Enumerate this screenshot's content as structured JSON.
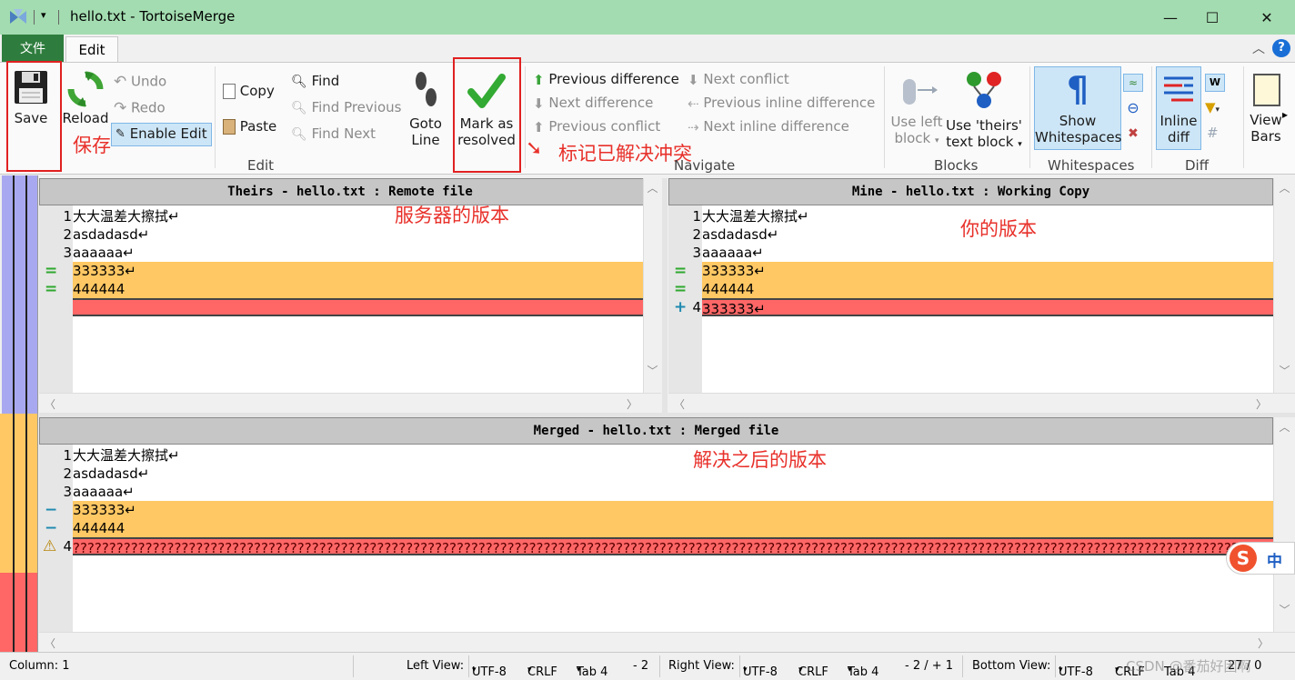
{
  "window": {
    "title": "hello.txt - TortoiseMerge",
    "minimize": "—",
    "maximize": "☐",
    "close": "✕"
  },
  "tabs": {
    "file": "文件",
    "edit": "Edit"
  },
  "ribbon": {
    "save": "Save",
    "reload": "Reload",
    "undo": "Undo",
    "redo": "Redo",
    "enable_edit": "Enable Edit",
    "copy": "Copy",
    "paste": "Paste",
    "find": "Find",
    "find_previous": "Find Previous",
    "find_next": "Find Next",
    "goto_1": "Goto",
    "goto_2": "Line",
    "mark_1": "Mark as",
    "mark_2": "resolved",
    "prev_diff": "Previous difference",
    "next_diff": "Next difference",
    "prev_conflict": "Previous conflict",
    "next_conflict": "Next conflict",
    "prev_inline": "Previous inline difference",
    "next_inline": "Next inline difference",
    "use_left_1": "Use left",
    "use_left_2": "block",
    "use_theirs_1": "Use 'theirs'",
    "use_theirs_2": "text block",
    "show_ws_1": "Show",
    "show_ws_2": "Whitespaces",
    "inline_1": "Inline",
    "inline_2": "diff",
    "view_1": "View",
    "view_2": "Bars",
    "groups": {
      "edit": "Edit",
      "navigate": "Navigate",
      "blocks": "Blocks",
      "whitespaces": "Whitespaces",
      "diff": "Diff"
    }
  },
  "annotations": {
    "save": "保存",
    "mark": "标记已解决冲突",
    "theirs": "服务器的版本",
    "mine": "你的版本",
    "merged": "解决之后的版本"
  },
  "panes": {
    "theirs": {
      "header": "Theirs - hello.txt : Remote file",
      "lines": [
        {
          "n": "1",
          "t": "大大温差大擦拭↵"
        },
        {
          "n": "2",
          "t": "asdadasd↵"
        },
        {
          "n": "3",
          "t": "aaaaaa↵"
        },
        {
          "m": "=",
          "t": "333333↵"
        },
        {
          "m": "=",
          "t": "444444"
        },
        {
          "t": ""
        }
      ]
    },
    "mine": {
      "header": "Mine - hello.txt : Working Copy",
      "lines": [
        {
          "n": "1",
          "t": "大大温差大擦拭↵"
        },
        {
          "n": "2",
          "t": "asdadasd↵"
        },
        {
          "n": "3",
          "t": "aaaaaa↵"
        },
        {
          "m": "=",
          "t": "333333↵"
        },
        {
          "m": "=",
          "t": "444444"
        },
        {
          "m": "+",
          "n": "4",
          "t": "333333↵"
        }
      ]
    },
    "merged": {
      "header": "Merged - hello.txt : Merged file",
      "lines": [
        {
          "n": "1",
          "t": "大大温差大擦拭↵"
        },
        {
          "n": "2",
          "t": "asdadasd↵"
        },
        {
          "n": "3",
          "t": "aaaaaa↵"
        },
        {
          "m": "−",
          "t": "333333↵"
        },
        {
          "m": "−",
          "t": "444444"
        },
        {
          "m": "⚠",
          "n": "4",
          "t": "????????????????????????????????????????????????????????????????????????????????????????????????????????????????????????????????????????????????????????????????????????????????????????????"
        }
      ]
    }
  },
  "status": {
    "column": "Column: 1",
    "left_view": "Left View:",
    "right_view": "Right View:",
    "bottom_view": "Bottom View:",
    "enc": "UTF-8",
    "eol": "CRLF",
    "tab": "Tab 4",
    "left_count": "- 2",
    "right_count": "- 2 / + 1",
    "bottom_tail": "27 / 0",
    "watermark": "CSDN @番茄好困啊"
  },
  "ime": {
    "label": "中"
  },
  "colors": {
    "title_bg": "#a3dcb0",
    "file_tab": "#2f7d3e",
    "conflict": "#ff6666",
    "identical": "#ffc864",
    "annotation": "#e8302a"
  }
}
